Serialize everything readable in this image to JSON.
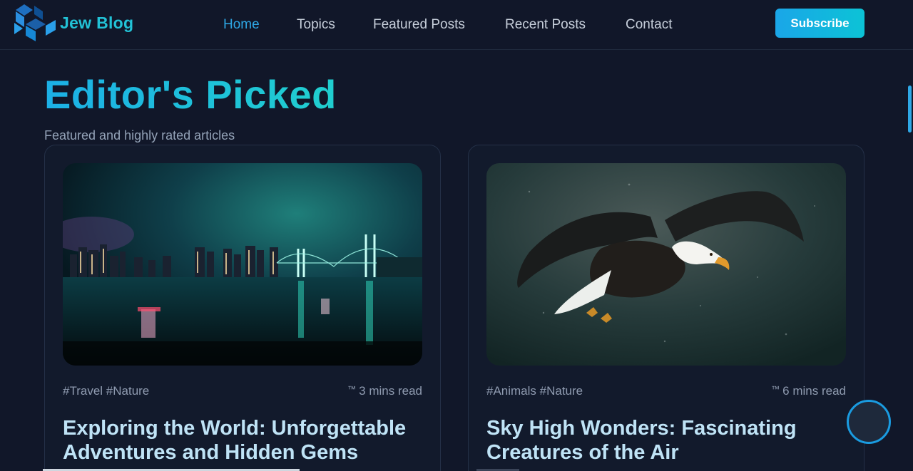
{
  "header": {
    "logo_text": "Jew Blog",
    "nav": [
      {
        "label": "Home",
        "active": true
      },
      {
        "label": "Topics",
        "active": false
      },
      {
        "label": "Featured Posts",
        "active": false
      },
      {
        "label": "Recent Posts",
        "active": false
      },
      {
        "label": "Contact",
        "active": false
      }
    ],
    "subscribe_label": "Subscribe"
  },
  "section": {
    "title": "Editor's Picked",
    "subtitle": "Featured and highly rated articles"
  },
  "cards": [
    {
      "image": "night-city-bridge",
      "tags": "#Travel #Nature",
      "read_icon": "™",
      "read_time": "3 mins read",
      "title": "Exploring the World: Unforgettable Adventures and Hidden Gems"
    },
    {
      "image": "flying-bald-eagle",
      "tags": "#Animals #Nature",
      "read_icon": "™",
      "read_time": "6 mins read",
      "title": "Sky High Wonders: Fascinating Creatures of the Air"
    }
  ],
  "colors": {
    "background": "#111729",
    "accent": "#1aa6e8",
    "accent_teal": "#20cfcf",
    "card_title": "#bfe3f6"
  }
}
